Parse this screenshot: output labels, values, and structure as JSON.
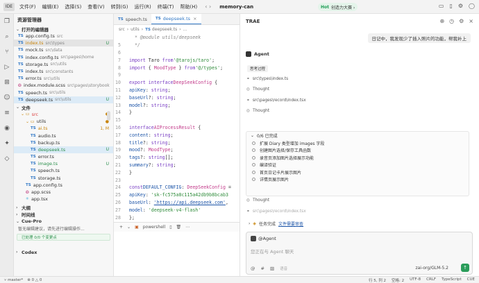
{
  "titlebar": {
    "ide": "IDE",
    "menus": [
      "文件(F)",
      "编辑(E)",
      "选择(S)",
      "查看(V)",
      "转到(G)",
      "运行(R)",
      "终端(T)",
      "帮助(H)"
    ],
    "project": "memory-can",
    "hot_tag": "Hot",
    "hot_text": "创造力大赛 ›"
  },
  "explorer": {
    "title": "资源管理器",
    "open_editors": "打开的编辑器",
    "open_files": [
      {
        "name": "app.config.ts",
        "path": "src",
        "badge": ""
      },
      {
        "name": "index.ts",
        "path": "src\\types",
        "badge": "U"
      },
      {
        "name": "mock.ts",
        "path": "src\\data",
        "badge": ""
      },
      {
        "name": "index.config.ts",
        "path": "src\\pages\\home",
        "badge": ""
      },
      {
        "name": "storage.ts",
        "path": "src\\utils",
        "badge": ""
      },
      {
        "name": "index.ts",
        "path": "src\\constants",
        "badge": ""
      },
      {
        "name": "error.ts",
        "path": "src\\utils",
        "badge": ""
      },
      {
        "name": "index.module.scss",
        "path": "src\\pages\\storybook",
        "badge": ""
      },
      {
        "name": "speech.ts",
        "path": "src\\utils",
        "badge": ""
      },
      {
        "name": "deepseek.ts",
        "path": "src\\utils",
        "badge": "U"
      }
    ],
    "files_section": "文件",
    "tree": [
      {
        "name": "src",
        "type": "folder",
        "indent": 1,
        "badge": "●"
      },
      {
        "name": "utils",
        "type": "folder",
        "indent": 2,
        "badge": "●"
      },
      {
        "name": "ai.ts",
        "type": "ts",
        "indent": 3,
        "badge": "1, M"
      },
      {
        "name": "audio.ts",
        "type": "ts",
        "indent": 3,
        "badge": ""
      },
      {
        "name": "backup.ts",
        "type": "ts",
        "indent": 3,
        "badge": ""
      },
      {
        "name": "deepseek.ts",
        "type": "ts",
        "indent": 3,
        "badge": "U"
      },
      {
        "name": "error.ts",
        "type": "ts",
        "indent": 3,
        "badge": ""
      },
      {
        "name": "image.ts",
        "type": "ts",
        "indent": 3,
        "badge": "U"
      },
      {
        "name": "speech.ts",
        "type": "ts",
        "indent": 3,
        "badge": ""
      },
      {
        "name": "storage.ts",
        "type": "ts",
        "indent": 3,
        "badge": ""
      },
      {
        "name": "app.config.ts",
        "type": "ts",
        "indent": 2,
        "badge": ""
      },
      {
        "name": "app.scss",
        "type": "scss",
        "indent": 2,
        "badge": ""
      },
      {
        "name": "app.tsx",
        "type": "tsx",
        "indent": 2,
        "badge": ""
      }
    ],
    "outline": "大纲",
    "timeline": "时间线",
    "cue_pro": "Cue-Pro",
    "cue_hint": "暂无编辑建议，请先进行编辑操作...",
    "cue_status": "已处理 0/0 个变更点",
    "codex": "Codex"
  },
  "editor": {
    "tabs": [
      {
        "label": "speech.ts",
        "active": false
      },
      {
        "label": "deepseek.ts",
        "active": true
      }
    ],
    "breadcrumb": [
      "src",
      "utils",
      "deepseek.ts",
      "..."
    ],
    "terminal": "powershell"
  },
  "chat": {
    "title": "TRAE",
    "user_message": "日记中，我发现少了插入照片的功能，帮我补上",
    "agent_name": "Agent",
    "thinking": "思考过程",
    "steps": [
      {
        "icon": "link",
        "text": "src\\types\\index.ts"
      },
      {
        "icon": "thought",
        "text": "Thought"
      },
      {
        "icon": "link",
        "text": "src\\pages\\record\\index.tsx"
      },
      {
        "icon": "thought",
        "text": "Thought"
      }
    ],
    "todo_header": "0/6 已完成",
    "todos": [
      "扩展 Diary 类型增加 images 字段",
      "创建图片选择/保存工具函数",
      "录音页添加图片选择展示功能",
      "编译验证",
      "首页日记卡片展示图片",
      "详情页展示图片"
    ],
    "thought_after": "Thought",
    "partial_line": "src\\pages\\record\\index.tsx",
    "task_status": "任务完成",
    "task_link": "文件需要审查",
    "input_agent": "@Agent",
    "input_placeholder": "您正在与 Agent 聊天",
    "mention_label": "语音",
    "model": "zai-org/GLM-5.2"
  },
  "status": {
    "branch": "master*",
    "errors": "0",
    "warnings": "0",
    "right": [
      "行 5, 列 2",
      "空格: 2",
      "UTF-8",
      "CRLF",
      "TypeScript",
      "CUE"
    ]
  }
}
